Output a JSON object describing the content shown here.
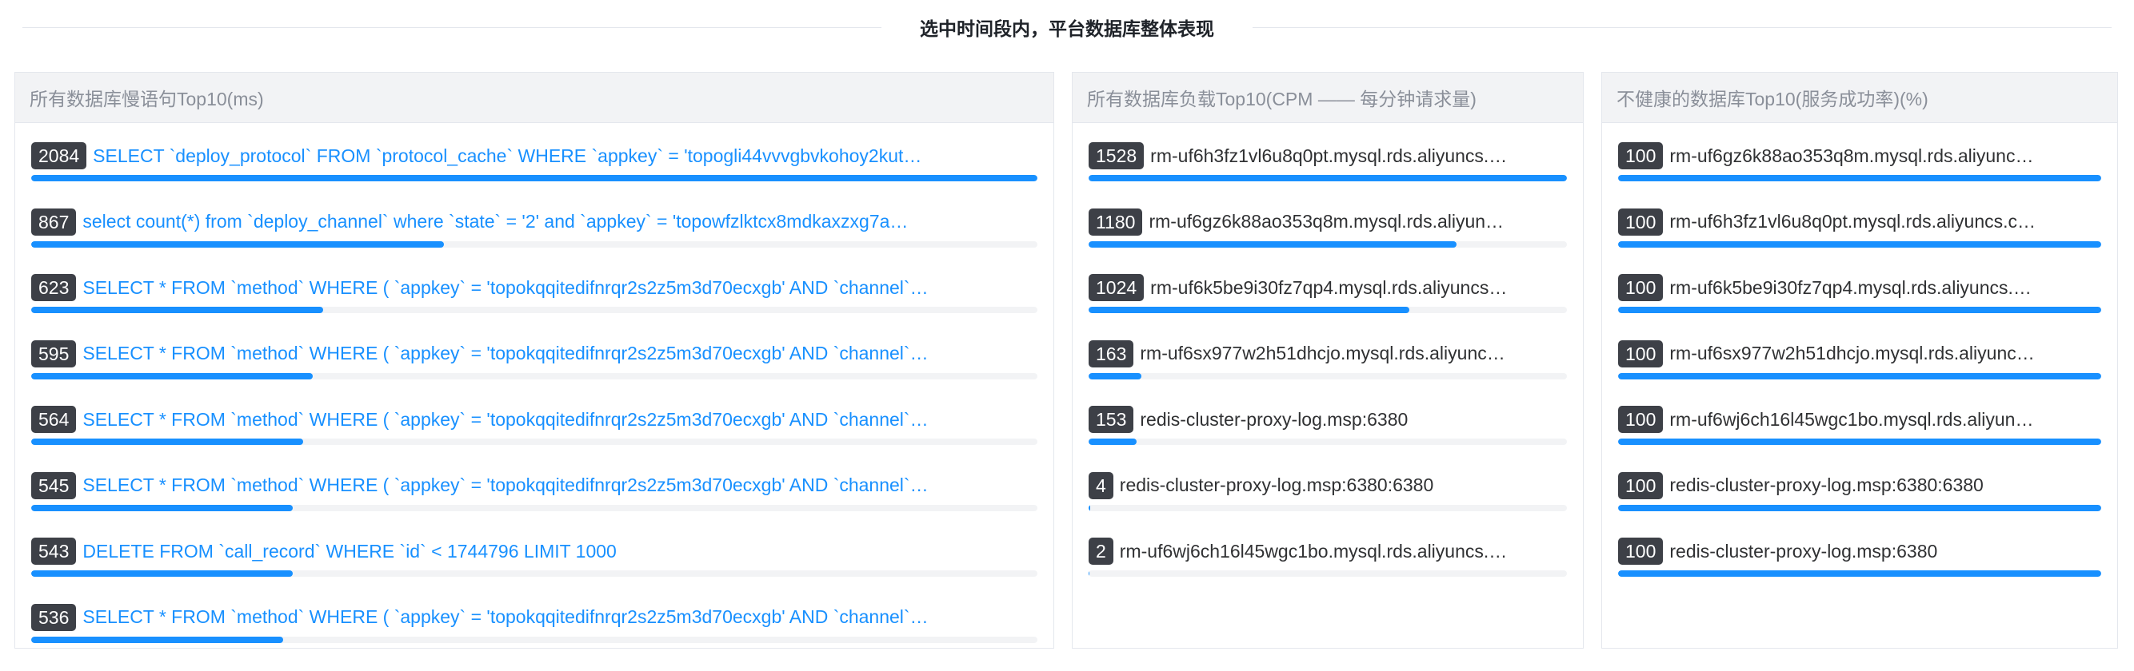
{
  "header": {
    "title": "选中时间段内，平台数据库整体表现"
  },
  "colors": {
    "accent": "#1890ff",
    "badge_bg": "#3d4047",
    "track": "#f2f3f5"
  },
  "panels": [
    {
      "title": "所有数据库慢语句Top10(ms)",
      "link_style": true,
      "rows": [
        {
          "value": "2084",
          "text": "SELECT `deploy_protocol` FROM `protocol_cache` WHERE `appkey` = 'topogli44vvvgbvkohoy2kut…",
          "fill": 1.0
        },
        {
          "value": "867",
          "text": "select count(*) from `deploy_channel` where `state` = '2' and `appkey` = 'topowfzlktcx8mdkaxzxg7a…",
          "fill": 0.41
        },
        {
          "value": "623",
          "text": "SELECT * FROM `method` WHERE ( `appkey` = 'topokqqitedifnrqr2s2z5m3d70ecxgb' AND `channel`…",
          "fill": 0.29
        },
        {
          "value": "595",
          "text": "SELECT * FROM `method` WHERE ( `appkey` = 'topokqqitedifnrqr2s2z5m3d70ecxgb' AND `channel`…",
          "fill": 0.28
        },
        {
          "value": "564",
          "text": "SELECT * FROM `method` WHERE ( `appkey` = 'topokqqitedifnrqr2s2z5m3d70ecxgb' AND `channel`…",
          "fill": 0.27
        },
        {
          "value": "545",
          "text": "SELECT * FROM `method` WHERE ( `appkey` = 'topokqqitedifnrqr2s2z5m3d70ecxgb' AND `channel`…",
          "fill": 0.26
        },
        {
          "value": "543",
          "text": "DELETE FROM `call_record` WHERE `id` < 1744796 LIMIT 1000",
          "fill": 0.26
        },
        {
          "value": "536",
          "text": "SELECT * FROM `method` WHERE ( `appkey` = 'topokqqitedifnrqr2s2z5m3d70ecxgb' AND `channel`…",
          "fill": 0.25
        }
      ]
    },
    {
      "title": "所有数据库负载Top10(CPM —— 每分钟请求量)",
      "link_style": false,
      "rows": [
        {
          "value": "1528",
          "text": "rm-uf6h3fz1vl6u8q0pt.mysql.rds.aliyuncs.…",
          "fill": 1.0
        },
        {
          "value": "1180",
          "text": "rm-uf6gz6k88ao353q8m.mysql.rds.aliyun…",
          "fill": 0.77
        },
        {
          "value": "1024",
          "text": "rm-uf6k5be9i30fz7qp4.mysql.rds.aliyuncs…",
          "fill": 0.67
        },
        {
          "value": "163",
          "text": "rm-uf6sx977w2h51dhcjo.mysql.rds.aliyunc…",
          "fill": 0.11
        },
        {
          "value": "153",
          "text": "redis-cluster-proxy-log.msp:6380",
          "fill": 0.1
        },
        {
          "value": "4",
          "text": "redis-cluster-proxy-log.msp:6380:6380",
          "fill": 0.003
        },
        {
          "value": "2",
          "text": "rm-uf6wj6ch16l45wgc1bo.mysql.rds.aliyuncs.…",
          "fill": 0.001
        }
      ]
    },
    {
      "title": "不健康的数据库Top10(服务成功率)(%)",
      "link_style": false,
      "rows": [
        {
          "value": "100",
          "text": "rm-uf6gz6k88ao353q8m.mysql.rds.aliyunc…",
          "fill": 1.0
        },
        {
          "value": "100",
          "text": "rm-uf6h3fz1vl6u8q0pt.mysql.rds.aliyuncs.c…",
          "fill": 1.0
        },
        {
          "value": "100",
          "text": "rm-uf6k5be9i30fz7qp4.mysql.rds.aliyuncs.…",
          "fill": 1.0
        },
        {
          "value": "100",
          "text": "rm-uf6sx977w2h51dhcjo.mysql.rds.aliyunc…",
          "fill": 1.0
        },
        {
          "value": "100",
          "text": "rm-uf6wj6ch16l45wgc1bo.mysql.rds.aliyun…",
          "fill": 1.0
        },
        {
          "value": "100",
          "text": "redis-cluster-proxy-log.msp:6380:6380",
          "fill": 1.0
        },
        {
          "value": "100",
          "text": "redis-cluster-proxy-log.msp:6380",
          "fill": 1.0
        }
      ]
    }
  ]
}
